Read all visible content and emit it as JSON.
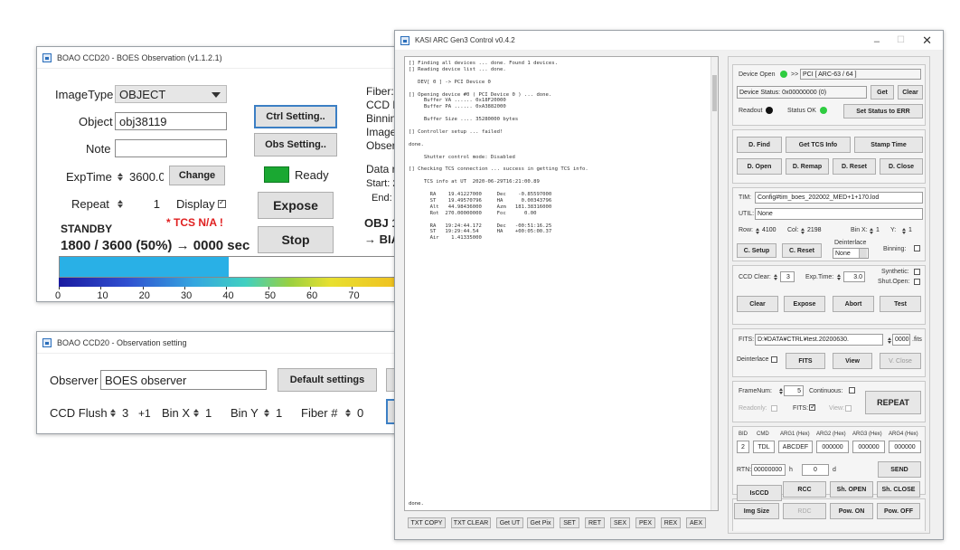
{
  "win1": {
    "title": "BOAO CCD20 - BOES Observation (v1.1.2.1)",
    "image_type_label": "ImageType",
    "image_type_value": "OBJECT",
    "object_label": "Object",
    "object_value": "obj38119",
    "note_label": "Note",
    "note_value": "",
    "exptime_label": "ExpTime",
    "exptime_value": "3600.0",
    "change_label": "Change",
    "repeat_label": "Repeat",
    "repeat_value": "1",
    "display_label": "Display",
    "tcs_warning": "* TCS N/A !",
    "status": "STANDBY",
    "progress_text": "1800 / 3600 (50%) → 0000 sec",
    "progress_fraction": 0.5,
    "ctrl_setting": "Ctrl Setting..",
    "obs_setting": "Obs Setting..",
    "ready_label": "Ready",
    "ready_color": "#1aa832",
    "expose_label": "Expose",
    "stop_label": "Stop",
    "right_labels": [
      "Fiber:",
      "CCD F",
      "Binnin",
      "Image",
      "Obser"
    ],
    "data_label": "Data r",
    "start_label": "Start: 2",
    "end_label": "End: 2",
    "obj_label": "OBJ 1",
    "bia_label": "→ BIA",
    "progress_color": "#29b0e6",
    "ticks": [
      "0",
      "10",
      "20",
      "30",
      "40",
      "50",
      "60",
      "70"
    ]
  },
  "win2": {
    "title": "BOAO CCD20 - Observation setting",
    "observer_label": "Observer",
    "observer_value": "BOES observer",
    "default_btn": "Default settings",
    "ccd_flush_label": "CCD Flush",
    "ccd_flush_value": "3",
    "plus1": "+1",
    "binx_label": "Bin X",
    "binx_value": "1",
    "biny_label": "Bin Y",
    "biny_value": "1",
    "fiber_label": "Fiber #",
    "fiber_value": "0"
  },
  "win3": {
    "title": "KASI ARC Gen3 Control v0.4.2",
    "log_lines": [
      "[] Finding all devices ... done. Found 1 devices.",
      "[] Reading device list ... done.",
      "",
      "   DEV[ 0 ] -> PCI Device 0",
      "",
      "[] Opening device #0 ( PCI Device 0 ) ... done.",
      "     Buffer VA ...... 0x18F20000",
      "     Buffer PA ...... 0xA3882000",
      "",
      "     Buffer Size .... 35280000 bytes",
      "",
      "[] Controller setup ... failed!",
      "",
      "done.",
      "",
      "     Shutter control mode: Disabled",
      "",
      "[] Checking TCS connection ... success in getting TCS info.",
      "",
      "     TCS info at UT  2020-06-29T16:21:00.89",
      "",
      "       RA    19.41227000     Dec    -0.85597000",
      "       ST    19.49570796     HA      0.00343796",
      "       Alt   44.98436000     Azm   181.38316000",
      "       Rot  270.00000000     Foc      0.00",
      "",
      "       RA   19:24:44.172     Dec   -00:51:16.25",
      "       ST   19:29:44.54      HA    +00:05:00.37",
      "       Air    1.41335000"
    ],
    "log_last": "done.",
    "bottom_buttons": [
      "TXT COPY",
      "TXT CLEAR",
      "Get UT",
      "Get Pix",
      "SET",
      "RET",
      "SEX",
      "PEX",
      "REX",
      "AEX"
    ],
    "device_open": "Device Open",
    "pci_label": "PCI [ ARC-63 / 64 ]",
    "device_status": "Device Status: 0x00000000 (0)",
    "get": "Get",
    "clear": "Clear",
    "readout": "Readout",
    "status_ok": "Status OK",
    "set_status": "Set Status to ERR",
    "d_find": "D. Find",
    "get_tcs": "Get TCS Info",
    "stamp_time": "Stamp Time",
    "d_open": "D. Open",
    "d_remap": "D. Remap",
    "d_reset": "D. Reset",
    "d_close": "D. Close",
    "tim_label": "TIM:",
    "tim_value": "Config#tim_boes_202002_MED+1+170.lod",
    "util_label": "UTIL:",
    "util_value": "None",
    "row_label": "Row:",
    "row_value": "4100",
    "col_label": "Col:",
    "col_value": "2198",
    "binx_label": "Bin X:",
    "binx_value": "1",
    "y_label": "Y:",
    "y_value": "1",
    "c_setup": "C. Setup",
    "c_reset": "C. Reset",
    "deinterlace": "Deinterlace",
    "deinterlace_value": "None",
    "binning": "Binning:",
    "ccd_clear": "CCD Clear:",
    "ccd_clear_value": "3",
    "exp_time": "Exp.Time:",
    "exp_time_value": "3.0",
    "synthetic": "Synthetic:",
    "shut_open": "Shut.Open:",
    "clear_btn": "Clear",
    "expose_btn": "Expose",
    "abort_btn": "Abort",
    "test_btn": "Test",
    "fits_label": "FITS:",
    "fits_value": "D:¥DATA¥CTRL¥test.20200630.",
    "fits_num": "0000",
    "fits_ext": ".fits",
    "deinterlace2": "Deinterlace",
    "fits_btn": "FITS",
    "view_btn": "View",
    "vclose_btn": "V. Close",
    "frame_num": "FrameNum:",
    "frame_num_value": "5",
    "continuous": "Continuous:",
    "readonly": "Readonly:",
    "fits_chk": "FITS:",
    "view_chk": "View:",
    "repeat_btn": "REPEAT",
    "cmd_headers": [
      "BID",
      "CMD",
      "ARG1 (Hex)",
      "ARG2 (Hex)",
      "ARG3 (Hex)",
      "ARG4 (Hex)"
    ],
    "cmd_values": [
      "2",
      "TDL",
      "ABCDEF",
      "000000",
      "000000",
      "000000"
    ],
    "rtn_label": "RTN:",
    "rtn_value": "00000000",
    "rtn_h": "h",
    "rtn_dec": "0",
    "rtn_d": "d",
    "send_btn": "SEND",
    "isccd": "IsCCD",
    "rcc": "RCC",
    "sh_open": "Sh. OPEN",
    "sh_close": "Sh. CLOSE",
    "img_size": "Img Size",
    "rdc": "RDC",
    "pow_on": "Pow. ON",
    "pow_off": "Pow. OFF",
    "led_green": "#2ecc40",
    "led_dark": "#111111"
  }
}
